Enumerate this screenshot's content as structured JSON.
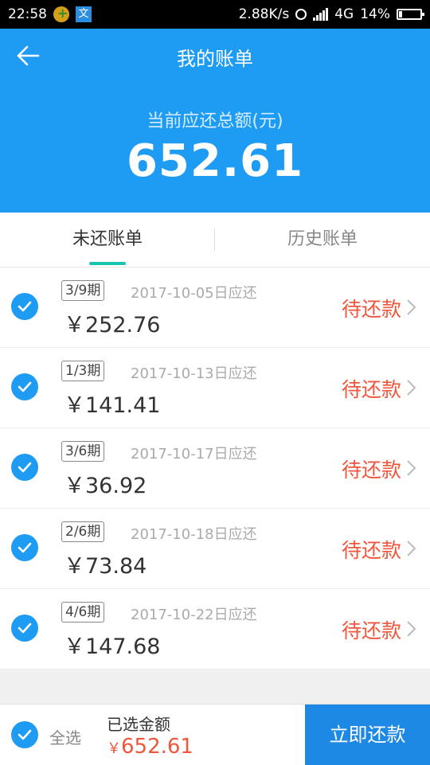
{
  "status_bar": {
    "time": "22:58",
    "network_speed": "2.88K/s",
    "network_type": "4G",
    "battery": "14%"
  },
  "header": {
    "title": "我的账单",
    "total_label": "当前应还总额(元)",
    "total_amount": "652.61"
  },
  "tabs": [
    {
      "label": "未还账单",
      "active": true
    },
    {
      "label": "历史账单",
      "active": false
    }
  ],
  "bills": [
    {
      "period": "3/9期",
      "due": "2017-10-05日应还",
      "amount": "￥252.76",
      "status": "待还款"
    },
    {
      "period": "1/3期",
      "due": "2017-10-13日应还",
      "amount": "￥141.41",
      "status": "待还款"
    },
    {
      "period": "3/6期",
      "due": "2017-10-17日应还",
      "amount": "￥36.92",
      "status": "待还款"
    },
    {
      "period": "2/6期",
      "due": "2017-10-18日应还",
      "amount": "￥73.84",
      "status": "待还款"
    },
    {
      "period": "4/6期",
      "due": "2017-10-22日应还",
      "amount": "￥147.68",
      "status": "待还款"
    }
  ],
  "footer": {
    "select_all": "全选",
    "selected_label": "已选金额",
    "selected_currency": "￥",
    "selected_amount": "652.61",
    "pay_button": "立即还款"
  },
  "colors": {
    "primary": "#1e9bf3",
    "accent": "#f0563b",
    "tab_indicator": "#18c5b0"
  }
}
